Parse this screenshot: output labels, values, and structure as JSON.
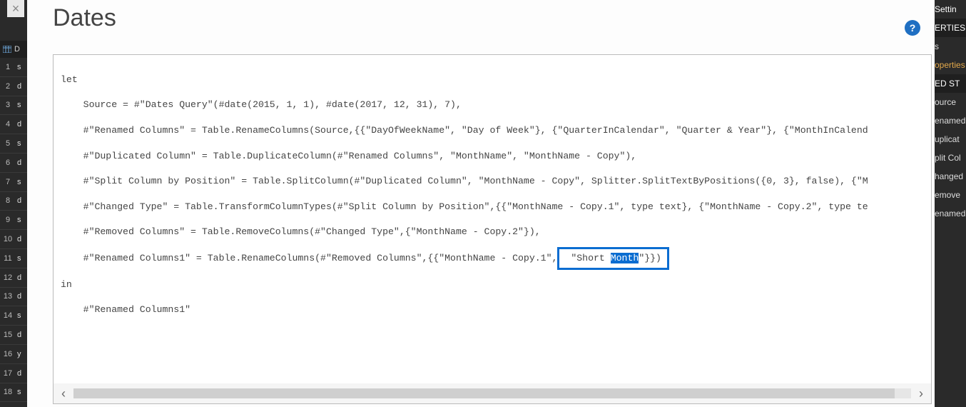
{
  "title": "Dates",
  "help_tooltip": "?",
  "left": {
    "header_label": "D",
    "rows": [
      {
        "n": "1",
        "v": "s"
      },
      {
        "n": "2",
        "v": "d"
      },
      {
        "n": "3",
        "v": "s"
      },
      {
        "n": "4",
        "v": "d"
      },
      {
        "n": "5",
        "v": "s"
      },
      {
        "n": "6",
        "v": "d"
      },
      {
        "n": "7",
        "v": "s"
      },
      {
        "n": "8",
        "v": "d"
      },
      {
        "n": "9",
        "v": "s"
      },
      {
        "n": "10",
        "v": "d"
      },
      {
        "n": "11",
        "v": "s"
      },
      {
        "n": "12",
        "v": "d"
      },
      {
        "n": "13",
        "v": "d"
      },
      {
        "n": "14",
        "v": "s"
      },
      {
        "n": "15",
        "v": "d"
      },
      {
        "n": "16",
        "v": "y"
      },
      {
        "n": "17",
        "v": "d"
      },
      {
        "n": "18",
        "v": "s"
      }
    ]
  },
  "right": {
    "items": [
      {
        "label": "Settin",
        "kind": "header"
      },
      {
        "label": "ERTIES",
        "kind": "section"
      },
      {
        "label": "s",
        "kind": "plain"
      },
      {
        "label": "operties",
        "kind": "link"
      },
      {
        "label": "ED ST",
        "kind": "section"
      },
      {
        "label": "ource",
        "kind": "plain"
      },
      {
        "label": "enamed",
        "kind": "plain"
      },
      {
        "label": "uplicat",
        "kind": "plain"
      },
      {
        "label": "plit Col",
        "kind": "plain"
      },
      {
        "label": "hanged",
        "kind": "plain"
      },
      {
        "label": "emove",
        "kind": "plain"
      },
      {
        "label": "enamed",
        "kind": "plain"
      }
    ]
  },
  "code": {
    "l1": "let",
    "l2": "    Source = #\"Dates Query\"(#date(2015, 1, 1), #date(2017, 12, 31), 7),",
    "l3": "    #\"Renamed Columns\" = Table.RenameColumns(Source,{{\"DayOfWeekName\", \"Day of Week\"}, {\"QuarterInCalendar\", \"Quarter & Year\"}, {\"MonthInCalend",
    "l4": "    #\"Duplicated Column\" = Table.DuplicateColumn(#\"Renamed Columns\", \"MonthName\", \"MonthName - Copy\"),",
    "l5": "    #\"Split Column by Position\" = Table.SplitColumn(#\"Duplicated Column\", \"MonthName - Copy\", Splitter.SplitTextByPositions({0, 3}, false), {\"M",
    "l6": "    #\"Changed Type\" = Table.TransformColumnTypes(#\"Split Column by Position\",{{\"MonthName - Copy.1\", type text}, {\"MonthName - Copy.2\", type te",
    "l7": "    #\"Removed Columns\" = Table.RemoveColumns(#\"Changed Type\",{\"MonthName - Copy.2\"}),",
    "l8a": "    #\"Renamed Columns1\" = Table.RenameColumns(#\"Removed Columns\",{{\"MonthName - Copy.1\",",
    "l8b_pre": " \"Short ",
    "l8b_sel": "Month",
    "l8b_post": "\"}})",
    "l9": "in",
    "l10": "    #\"Renamed Columns1\""
  }
}
